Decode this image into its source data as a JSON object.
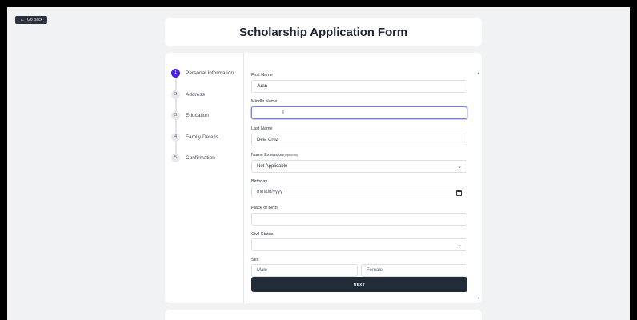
{
  "back_button": {
    "label": "Go Back",
    "icon": "arrow-left-icon"
  },
  "title": "Scholarship Application Form",
  "steps": [
    {
      "number": "1",
      "label": "Personal Information",
      "active": true
    },
    {
      "number": "2",
      "label": "Address",
      "active": false
    },
    {
      "number": "3",
      "label": "Education",
      "active": false
    },
    {
      "number": "4",
      "label": "Family Details",
      "active": false
    },
    {
      "number": "5",
      "label": "Confirmation",
      "active": false
    }
  ],
  "form": {
    "first_name": {
      "label": "First Name",
      "value": "Juan"
    },
    "middle_name": {
      "label": "Middle Name",
      "value": ""
    },
    "last_name": {
      "label": "Last Name",
      "value": "Dela Cruz"
    },
    "name_extension": {
      "label": "Name Extension",
      "optional": "(Optional)",
      "value": "Not Applicable"
    },
    "birthday": {
      "label": "Birthday",
      "placeholder": "mm/dd/yyyy"
    },
    "place_of_birth": {
      "label": "Place of Birth",
      "value": ""
    },
    "civil_status": {
      "label": "Civil Status",
      "value": ""
    },
    "sex": {
      "label": "Sex",
      "options": [
        "Male",
        "Female"
      ]
    },
    "next_label": "NEXT"
  },
  "accent_color": "#4b24e0",
  "button_color": "#222b38"
}
